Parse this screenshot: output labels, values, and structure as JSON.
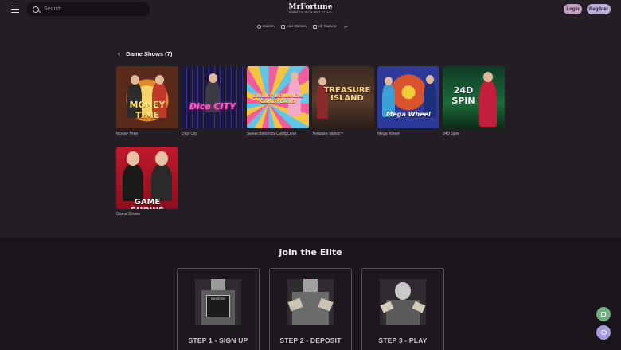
{
  "header": {
    "search_placeholder": "Search",
    "logo_text": "MrFortune",
    "logo_tagline": "WHERE THE ELITE MEET TO PLAY",
    "login_label": "Login",
    "register_label": "Register"
  },
  "catnav": {
    "items": [
      {
        "label": "Casino",
        "icon": "casino-icon"
      },
      {
        "label": "Live Casino",
        "icon": "live-casino-icon"
      },
      {
        "label": "All Games",
        "icon": "all-games-icon"
      }
    ],
    "filter_icon": "filter-icon"
  },
  "section": {
    "title": "Game Shows (7)"
  },
  "games": [
    {
      "name": "Money Time",
      "art_title": "MONEY TIME"
    },
    {
      "name": "Dice City",
      "art_title": "Dice CITY"
    },
    {
      "name": "Sweet Bonanza CandyLand",
      "art_title": "SWEET BONANZA CANDYLAND"
    },
    {
      "name": "Treasure Island™",
      "art_title": "TREASURE ISLAND"
    },
    {
      "name": "Mega Wheel",
      "art_title": "Mega Wheel"
    },
    {
      "name": "24D Spin",
      "art_title": "24D SPIN"
    },
    {
      "name": "Game Shows",
      "art_title": "GAME SHOWS"
    }
  ],
  "join": {
    "title": "Join the Elite",
    "steps": [
      {
        "label": "STEP 1 - SIGN UP",
        "art_text": "REGISTER"
      },
      {
        "label": "STEP 2 - DEPOSIT"
      },
      {
        "label": "STEP 3 - PLAY"
      }
    ]
  },
  "colors": {
    "background": "#231d24",
    "login": "#c6a0c2",
    "register": "#b6acd8",
    "fab_green": "#6db07d",
    "fab_purple": "#a49be0"
  }
}
